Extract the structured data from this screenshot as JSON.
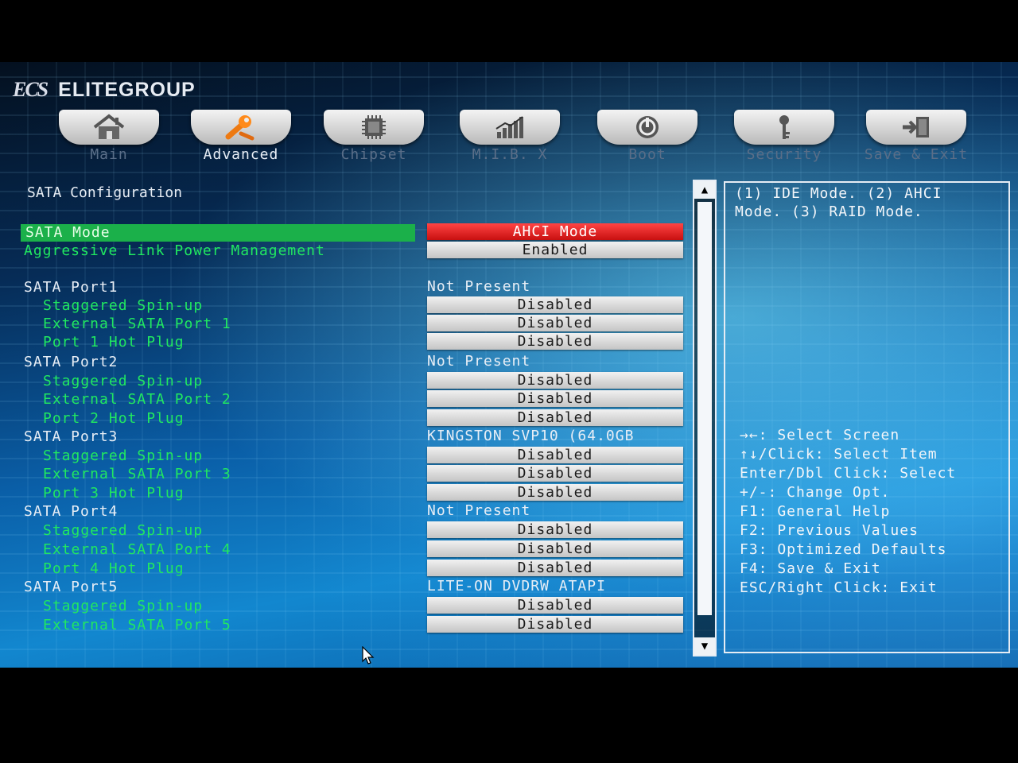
{
  "brand": {
    "logo": "ECS",
    "name": "ELITEGROUP"
  },
  "tabs": [
    {
      "label": "Main",
      "icon": "house-icon"
    },
    {
      "label": "Advanced",
      "icon": "wrench-icon",
      "active": true
    },
    {
      "label": "Chipset",
      "icon": "chip-icon"
    },
    {
      "label": "M.I.B. X",
      "icon": "bar-chart-icon"
    },
    {
      "label": "Boot",
      "icon": "power-icon"
    },
    {
      "label": "Security",
      "icon": "key-icon"
    },
    {
      "label": "Save & Exit",
      "icon": "exit-door-icon"
    }
  ],
  "section_title": "SATA Configuration",
  "settings": [
    {
      "label": "SATA Mode",
      "style": "selected",
      "value": "AHCI Mode",
      "value_style": "red"
    },
    {
      "label": "Aggressive Link Power Management",
      "style": "green",
      "value": "Enabled",
      "value_style": "box"
    },
    {
      "label": "SATA Port1",
      "style": "white",
      "value": "Not Present",
      "value_style": "text"
    },
    {
      "label": "Staggered Spin-up",
      "style": "green",
      "indent": true,
      "value": "Disabled",
      "value_style": "box"
    },
    {
      "label": "External SATA Port 1",
      "style": "green",
      "indent": true,
      "value": "Disabled",
      "value_style": "box"
    },
    {
      "label": "Port 1 Hot Plug",
      "style": "green",
      "indent": true,
      "value": "Disabled",
      "value_style": "box"
    },
    {
      "label": "SATA Port2",
      "style": "white",
      "value": "Not Present",
      "value_style": "text"
    },
    {
      "label": "Staggered Spin-up",
      "style": "green",
      "indent": true,
      "value": "Disabled",
      "value_style": "box"
    },
    {
      "label": "External SATA Port 2",
      "style": "green",
      "indent": true,
      "value": "Disabled",
      "value_style": "box"
    },
    {
      "label": "Port 2 Hot Plug",
      "style": "green",
      "indent": true,
      "value": "Disabled",
      "value_style": "box"
    },
    {
      "label": "SATA Port3",
      "style": "white",
      "value": "KINGSTON SVP10 (64.0GB",
      "value_style": "text"
    },
    {
      "label": "Staggered Spin-up",
      "style": "green",
      "indent": true,
      "value": "Disabled",
      "value_style": "box"
    },
    {
      "label": "External SATA Port 3",
      "style": "green",
      "indent": true,
      "value": "Disabled",
      "value_style": "box"
    },
    {
      "label": "Port 3 Hot Plug",
      "style": "green",
      "indent": true,
      "value": "Disabled",
      "value_style": "box"
    },
    {
      "label": "SATA Port4",
      "style": "white",
      "value": "Not Present",
      "value_style": "text"
    },
    {
      "label": "Staggered Spin-up",
      "style": "green",
      "indent": true,
      "value": "Disabled",
      "value_style": "box"
    },
    {
      "label": "External SATA Port 4",
      "style": "green",
      "indent": true,
      "value": "Disabled",
      "value_style": "box"
    },
    {
      "label": "Port 4 Hot Plug",
      "style": "green",
      "indent": true,
      "value": "Disabled",
      "value_style": "box"
    },
    {
      "label": "SATA Port5",
      "style": "white",
      "value": "LITE-ON DVDRW  ATAPI",
      "value_style": "text"
    },
    {
      "label": "Staggered Spin-up",
      "style": "green",
      "indent": true,
      "value": "Disabled",
      "value_style": "box"
    },
    {
      "label": "External SATA Port 5",
      "style": "green",
      "indent": true,
      "value": "Disabled",
      "value_style": "box"
    }
  ],
  "help": {
    "text": "(1) IDE Mode. (2) AHCI Mode. (3) RAID Mode."
  },
  "keys": [
    "→←: Select Screen",
    "↑↓/Click: Select Item",
    "Enter/Dbl Click: Select",
    "+/-: Change Opt.",
    "F1: General Help",
    "F2: Previous Values",
    "F3: Optimized Defaults",
    "F4: Save & Exit",
    "ESC/Right Click: Exit"
  ],
  "scroll": {
    "up": "▲",
    "down": "▼"
  },
  "colors": {
    "selected": "#1bb04a",
    "label_green": "#20e860",
    "value_red": "#d01414"
  }
}
